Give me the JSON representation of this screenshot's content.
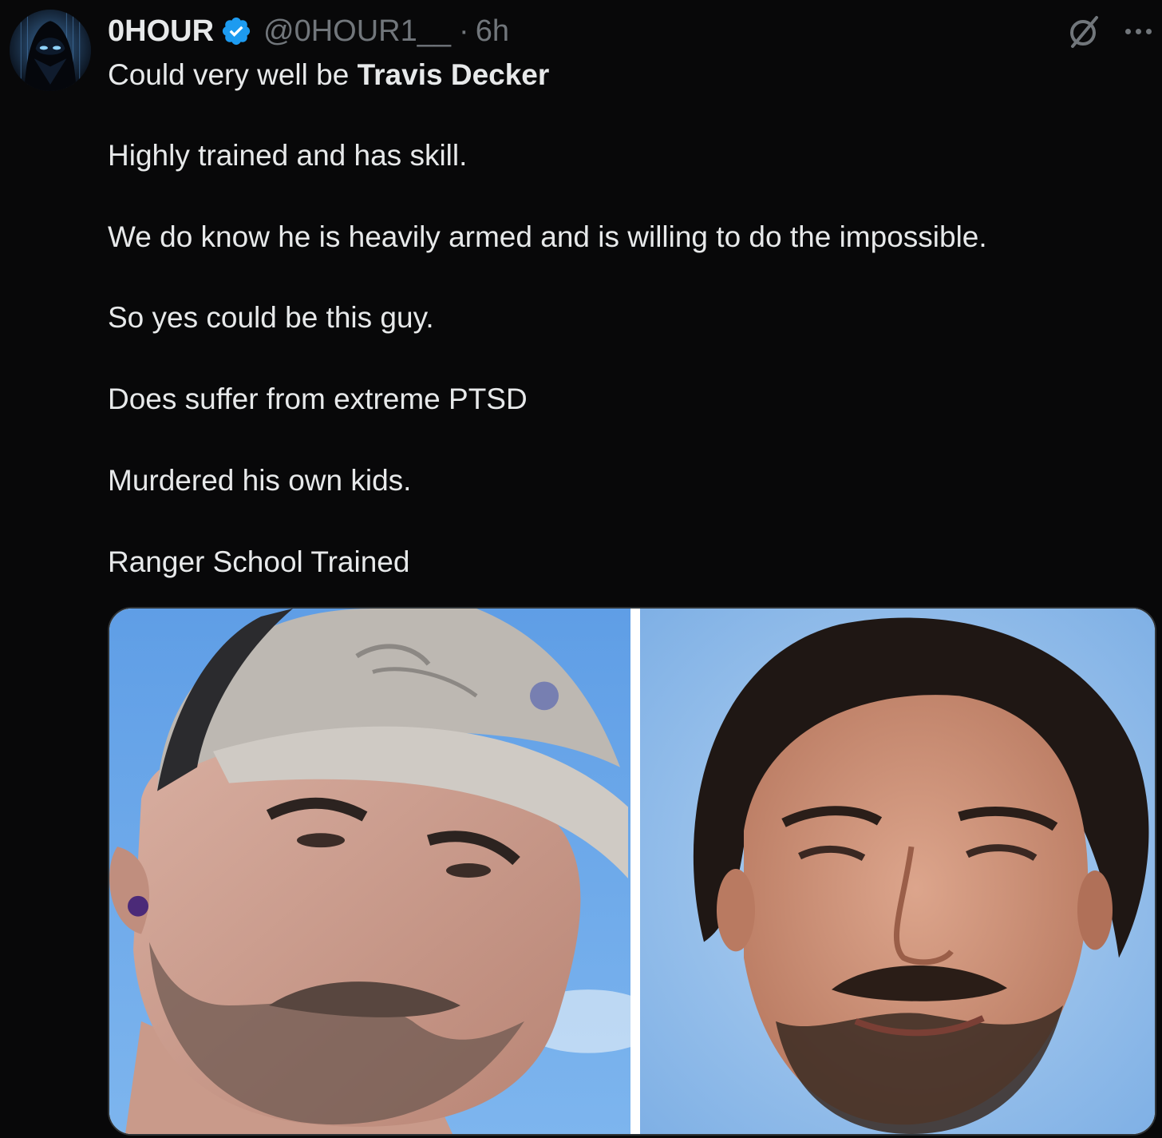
{
  "tweet": {
    "author": {
      "display_name": "0HOUR",
      "handle": "@0HOUR1__",
      "verified": true,
      "avatar_icon": "hooded-figure-avatar"
    },
    "separator": "·",
    "time": "6h",
    "text": {
      "line1_prefix": "Could very well be ",
      "line1_bold": "Travis Decker",
      "line2": "Highly trained and has skill.",
      "line3": "We do know he is heavily armed and is willing to do the impossible.",
      "line4": "So yes could be this guy.",
      "line5": "Does suffer from extreme PTSD",
      "line6": "Murdered his own kids.",
      "line7": "Ranger School Trained"
    },
    "media": {
      "left_photo": "man-in-cap-photo",
      "right_photo": "man-id-photo"
    },
    "icons": {
      "grok": "grok-icon",
      "more": "more-options-icon",
      "verified": "verified-badge-icon"
    },
    "colors": {
      "background": "#080809",
      "text": "#e7e9ea",
      "muted": "#71767b",
      "verified_blue": "#1d9bf0"
    }
  }
}
